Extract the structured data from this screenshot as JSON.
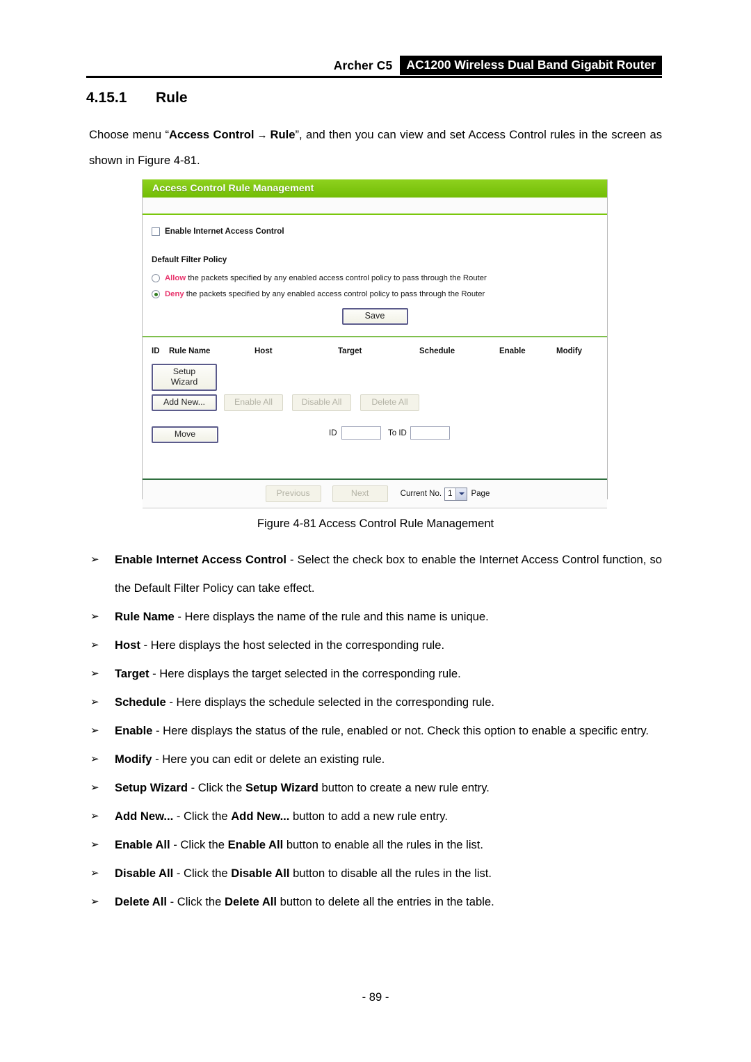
{
  "header": {
    "model": "Archer C5",
    "product": "AC1200 Wireless Dual Band Gigabit Router"
  },
  "section": {
    "number": "4.15.1",
    "title": "Rule"
  },
  "intro": {
    "prefix": "Choose menu “",
    "menu_root": "Access Control",
    "arrow": "→",
    "menu_leaf": "Rule",
    "suffix": "”, and then you can view and set Access Control rules in the screen as shown in Figure 4-81."
  },
  "screenshot": {
    "title": "Access Control Rule Management",
    "enable_checkbox_label": "Enable Internet Access Control",
    "filter_policy_title": "Default Filter Policy",
    "policy_allow_keyword": "Allow",
    "policy_allow_text": " the packets specified by any enabled access control policy to pass through the Router",
    "policy_deny_keyword": "Deny",
    "policy_deny_text": " the packets specified by any enabled access control policy to pass through the Router",
    "save_label": "Save",
    "columns": {
      "id": "ID",
      "rule_name": "Rule Name",
      "host": "Host",
      "target": "Target",
      "schedule": "Schedule",
      "enable": "Enable",
      "modify": "Modify"
    },
    "setup_wizard_label": "Setup Wizard",
    "add_new_label": "Add New...",
    "enable_all_label": "Enable All",
    "disable_all_label": "Disable All",
    "delete_all_label": "Delete All",
    "move_label": "Move",
    "move_id_label": "ID",
    "move_to_id_label": "To ID",
    "move_id_value": "",
    "move_to_id_value": "",
    "previous_label": "Previous",
    "next_label": "Next",
    "current_no_label": "Current No.",
    "page_select_value": "1",
    "page_label": "Page",
    "accent_green": "#7ac70c",
    "policy_keyword_color": "#e8356d"
  },
  "figure_caption": "Figure 4-81 Access Control Rule Management",
  "bullets": [
    {
      "mark": "➢",
      "term": "Enable Internet Access Control",
      "text": " - Select the check box to enable the Internet Access Control function, so the Default Filter Policy can take effect."
    },
    {
      "mark": "➢",
      "term": "Rule Name",
      "text": " - Here displays the name of the rule and this name is unique."
    },
    {
      "mark": "➢",
      "term": "Host",
      "text": " - Here displays the host selected in the corresponding rule."
    },
    {
      "mark": "➢",
      "term": "Target",
      "text": " - Here displays the target selected in the corresponding rule."
    },
    {
      "mark": "➢",
      "term": "Schedule",
      "text": " - Here displays the schedule selected in the corresponding rule."
    },
    {
      "mark": "➢",
      "term": "Enable",
      "text": " - Here displays the status of the rule, enabled or not. Check this option to enable a specific entry."
    },
    {
      "mark": "➢",
      "term": "Modify",
      "text": " - Here you can edit or delete an existing rule."
    },
    {
      "mark": "➢",
      "term": "Setup Wizard",
      "text_before": " - Click the ",
      "term2": "Setup Wizard",
      "text_after": " button to create a new rule entry."
    },
    {
      "mark": "➢",
      "term": "Add New...",
      "text_before": "  - Click the ",
      "term2": "Add New...",
      "text_after": " button to add a new rule entry."
    },
    {
      "mark": "➢",
      "term": "Enable All",
      "text_before": " - Click the ",
      "term2": "Enable All",
      "text_after": " button to enable all the rules in the list."
    },
    {
      "mark": "➢",
      "term": "Disable All",
      "text_before": " - Click the ",
      "term2": "Disable All",
      "text_after": " button to disable all the rules in the list."
    },
    {
      "mark": "➢",
      "term": "Delete All",
      "text_before": " - Click the ",
      "term2": "Delete All",
      "text_after": " button to delete all the entries in the table."
    }
  ],
  "footer": {
    "page_number": "- 89 -"
  }
}
